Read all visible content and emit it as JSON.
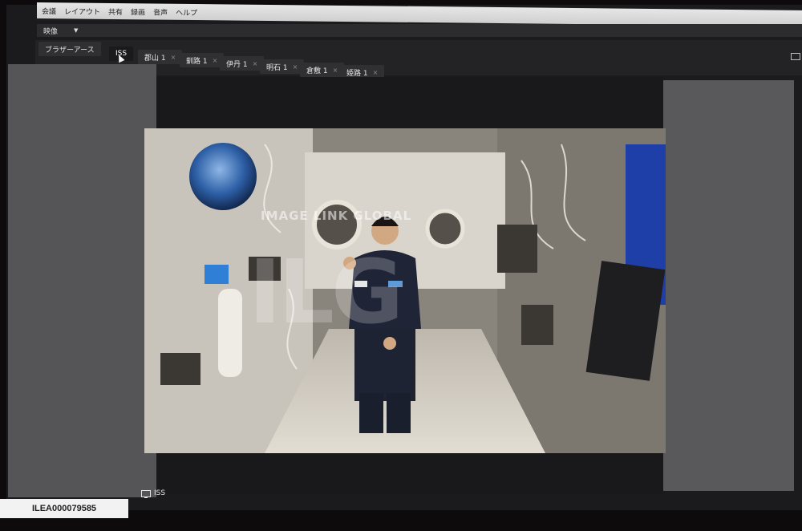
{
  "menu": {
    "items": [
      "会議",
      "レイアウト",
      "共有",
      "録画",
      "音声",
      "ヘルプ"
    ]
  },
  "subbar": {
    "label": "映像",
    "dropdown_icon": "chevron-down-icon"
  },
  "tabs": [
    {
      "label": "ブラザーアース",
      "active": false
    },
    {
      "label": "ISS",
      "active": true
    },
    {
      "label": "郡山 1",
      "active": false
    },
    {
      "label": "釧路 1",
      "active": false
    },
    {
      "label": "伊丹 1",
      "active": false
    },
    {
      "label": "明石 1",
      "active": false
    },
    {
      "label": "倉敷 1",
      "active": false
    },
    {
      "label": "姫路 1",
      "active": false
    }
  ],
  "watermark": {
    "text": "IMAGE LINK GLOBAL",
    "logo": "ILG"
  },
  "status": {
    "icon": "monitor-icon",
    "label": "ISS"
  },
  "image_id": "ILEA000079585",
  "colors": {
    "menubar": "#e0e0e0",
    "panel": "#555457",
    "background": "#0d0b0c"
  }
}
